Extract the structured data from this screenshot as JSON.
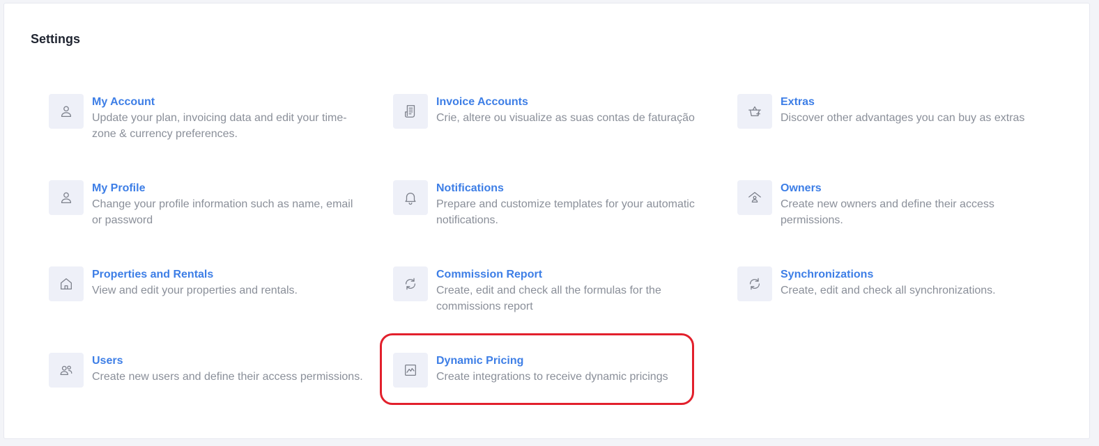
{
  "page": {
    "title": "Settings"
  },
  "settings": {
    "items": [
      {
        "icon": "user-icon",
        "title": "My Account",
        "description": "Update your plan, invoicing data and edit your time-zone & currency preferences."
      },
      {
        "icon": "invoice-icon",
        "title": "Invoice Accounts",
        "description": "Crie, altere ou visualize as suas contas de faturação"
      },
      {
        "icon": "basket-icon",
        "title": "Extras",
        "description": "Discover other advantages you can buy as extras"
      },
      {
        "icon": "user-icon",
        "title": "My Profile",
        "description": "Change your profile information such as name, email or password"
      },
      {
        "icon": "bell-icon",
        "title": "Notifications",
        "description": "Prepare and customize templates for your automatic notifications."
      },
      {
        "icon": "owner-house-icon",
        "title": "Owners",
        "description": "Create new owners and define their access permissions."
      },
      {
        "icon": "home-icon",
        "title": "Properties and Rentals",
        "description": "View and edit your properties and rentals."
      },
      {
        "icon": "refresh-icon",
        "title": "Commission Report",
        "description": "Create, edit and check all the formulas for the commissions report"
      },
      {
        "icon": "refresh-icon",
        "title": "Synchronizations",
        "description": "Create, edit and check all synchronizations."
      },
      {
        "icon": "users-icon",
        "title": "Users",
        "description": "Create new users and define their access permissions."
      },
      {
        "icon": "chart-line-icon",
        "title": "Dynamic Pricing",
        "description": "Create integrations to receive dynamic pricings"
      }
    ]
  },
  "colors": {
    "title_link": "#3d7ee6",
    "description": "#8a8f99",
    "icon_bg": "#eef0f8",
    "highlight": "#e2202c"
  }
}
